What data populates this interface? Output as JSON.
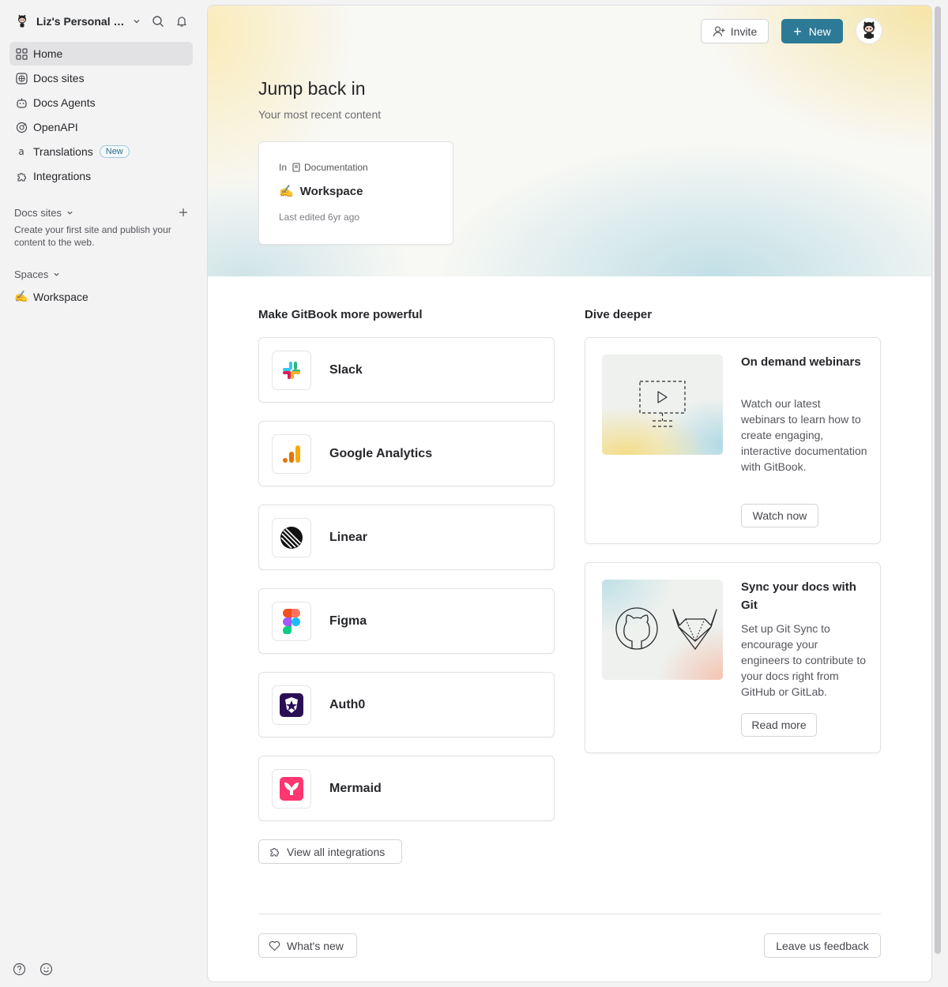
{
  "sidebar": {
    "org_name": "Liz's Personal O...",
    "nav": [
      {
        "label": "Home",
        "icon": "grid-icon",
        "active": true
      },
      {
        "label": "Docs sites",
        "icon": "globe-icon"
      },
      {
        "label": "Docs Agents",
        "icon": "agent-icon"
      },
      {
        "label": "OpenAPI",
        "icon": "openapi-icon"
      },
      {
        "label": "Translations",
        "icon": "translate-icon",
        "badge": "New"
      },
      {
        "label": "Integrations",
        "icon": "puzzle-icon"
      }
    ],
    "docs_sites_title": "Docs sites",
    "docs_sites_desc": "Create your first site and publish your content to the web.",
    "spaces_title": "Spaces",
    "space_item": {
      "emoji": "✍️",
      "label": "Workspace"
    }
  },
  "header": {
    "invite_label": "Invite",
    "new_label": "New",
    "accent_color": "#2d7a97"
  },
  "hero": {
    "title": "Jump back in",
    "subtitle": "Your most recent content",
    "recent": {
      "in_label": "In",
      "collection": "Documentation",
      "emoji": "✍️",
      "title": "Workspace",
      "meta": "Last edited 6yr ago"
    }
  },
  "integrations": {
    "title": "Make GitBook more powerful",
    "items": [
      {
        "name": "Slack",
        "icon": "slack-icon"
      },
      {
        "name": "Google Analytics",
        "icon": "google-analytics-icon"
      },
      {
        "name": "Linear",
        "icon": "linear-icon"
      },
      {
        "name": "Figma",
        "icon": "figma-icon"
      },
      {
        "name": "Auth0",
        "icon": "auth0-icon"
      },
      {
        "name": "Mermaid",
        "icon": "mermaid-icon"
      }
    ],
    "view_all_label": "View all integrations"
  },
  "dive_deeper": {
    "title": "Dive deeper",
    "cards": [
      {
        "title": "On demand webinars",
        "desc": "Watch our latest webinars to learn how to create engaging, interactive documentation with GitBook.",
        "button": "Watch now"
      },
      {
        "title": "Sync your docs with Git",
        "desc": "Set up Git Sync to encourage your engineers to contribute to your docs right from GitHub or GitLab.",
        "button": "Read more"
      }
    ]
  },
  "footer": {
    "whats_new_label": "What's new",
    "feedback_label": "Leave us feedback"
  }
}
